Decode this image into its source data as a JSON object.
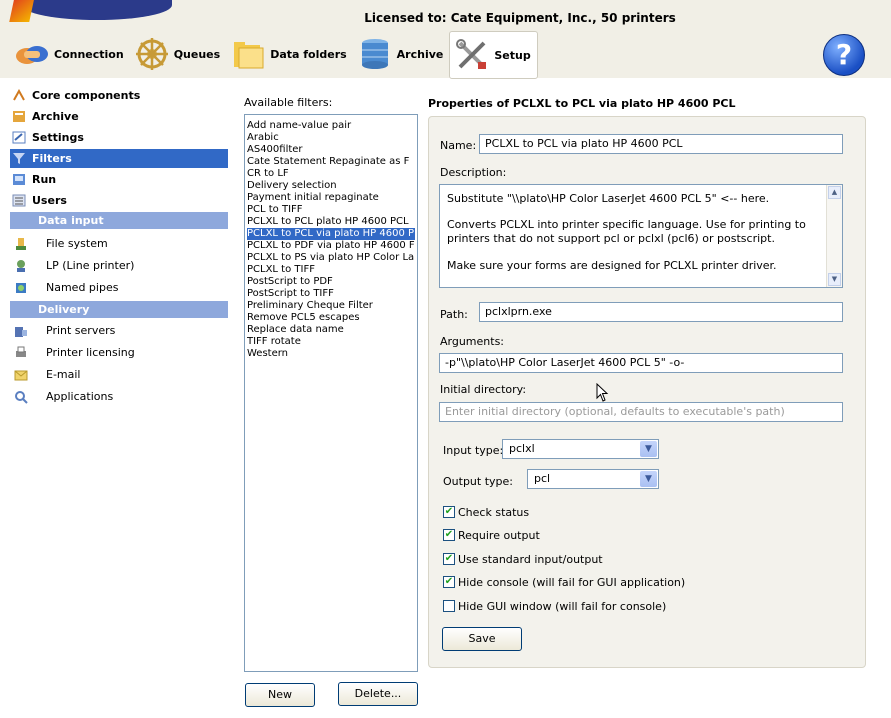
{
  "header": {
    "licensed_text": "Licensed to: Cate Equipment, Inc., 50 printers",
    "toolbar": [
      {
        "label": "Connection",
        "icon": "connection-icon"
      },
      {
        "label": "Queues",
        "icon": "queues-icon"
      },
      {
        "label": "Data folders",
        "icon": "data-folders-icon"
      },
      {
        "label": "Archive",
        "icon": "archive-icon"
      },
      {
        "label": "Setup",
        "icon": "setup-icon",
        "active": true
      }
    ],
    "help": "?"
  },
  "sidebar": {
    "items": [
      {
        "label": "Core components",
        "icon": "core-components-icon"
      },
      {
        "label": "Archive",
        "icon": "archive-icon"
      },
      {
        "label": "Settings",
        "icon": "settings-icon"
      },
      {
        "label": "Filters",
        "icon": "filters-icon",
        "selected": true
      },
      {
        "label": "Run",
        "icon": "run-icon"
      },
      {
        "label": "Users",
        "icon": "users-icon"
      }
    ],
    "data_input": {
      "title": "Data input",
      "items": [
        {
          "label": "File system",
          "icon": "file-system-icon"
        },
        {
          "label": "LP (Line printer)",
          "icon": "line-printer-icon"
        },
        {
          "label": "Named pipes",
          "icon": "named-pipes-icon"
        }
      ]
    },
    "delivery": {
      "title": "Delivery",
      "items": [
        {
          "label": "Print servers",
          "icon": "print-servers-icon"
        },
        {
          "label": "Printer licensing",
          "icon": "printer-licensing-icon"
        },
        {
          "label": "E-mail",
          "icon": "email-icon"
        },
        {
          "label": "Applications",
          "icon": "applications-icon"
        }
      ]
    }
  },
  "filters": {
    "label": "Available filters:",
    "items": [
      "Add name-value pair",
      "Arabic",
      "AS400filter",
      "Cate Statement Repaginate as F",
      "CR to LF",
      "Delivery selection",
      "Payment initial repaginate",
      "PCL to TIFF",
      "PCLXL to PCL plato HP 4600 PCL",
      "PCLXL to PCL via plato HP 4600 P",
      "PCLXL to PDF via plato HP 4600 F",
      "PCLXL to PS via plato HP Color La",
      "PCLXL to TIFF",
      "PostScript to PDF",
      "PostScript to TIFF",
      "Preliminary Cheque Filter",
      "Remove PCL5 escapes",
      "Replace data name",
      "TIFF rotate",
      "Western"
    ],
    "selected_index": 9,
    "new_button": "New",
    "delete_button": "Delete..."
  },
  "properties": {
    "title": "Properties of PCLXL to PCL via plato HP 4600 PCL",
    "name_label": "Name:",
    "name_value": "PCLXL to PCL via plato HP 4600 PCL",
    "description_label": "Description:",
    "description_lines": [
      "Substitute \"\\\\plato\\HP Color LaserJet 4600 PCL 5\" <-- here.",
      "",
      "Converts PCLXL into printer specific language. Use for printing to",
      "printers that do not support pcl or pclxl (pcl6) or postscript.",
      "",
      "Make sure your forms are designed for PCLXL printer driver."
    ],
    "path_label": "Path:",
    "path_value": "pclxlprn.exe",
    "arguments_label": "Arguments:",
    "arguments_value": "-p\"\\\\plato\\HP Color LaserJet 4600 PCL 5\" -o-",
    "initial_dir_label": "Initial directory:",
    "initial_dir_placeholder": "Enter initial directory (optional, defaults to executable's path)",
    "input_type_label": "Input type:",
    "input_type_value": "pclxl",
    "output_type_label": "Output type:",
    "output_type_value": "pcl",
    "checkboxes": [
      {
        "label": "Check status",
        "checked": true
      },
      {
        "label": "Require output",
        "checked": true
      },
      {
        "label": "Use standard input/output",
        "checked": true
      },
      {
        "label": "Hide console (will fail for GUI application)",
        "checked": true
      },
      {
        "label": "Hide GUI window (will fail for console)",
        "checked": false
      }
    ],
    "save_button": "Save"
  }
}
